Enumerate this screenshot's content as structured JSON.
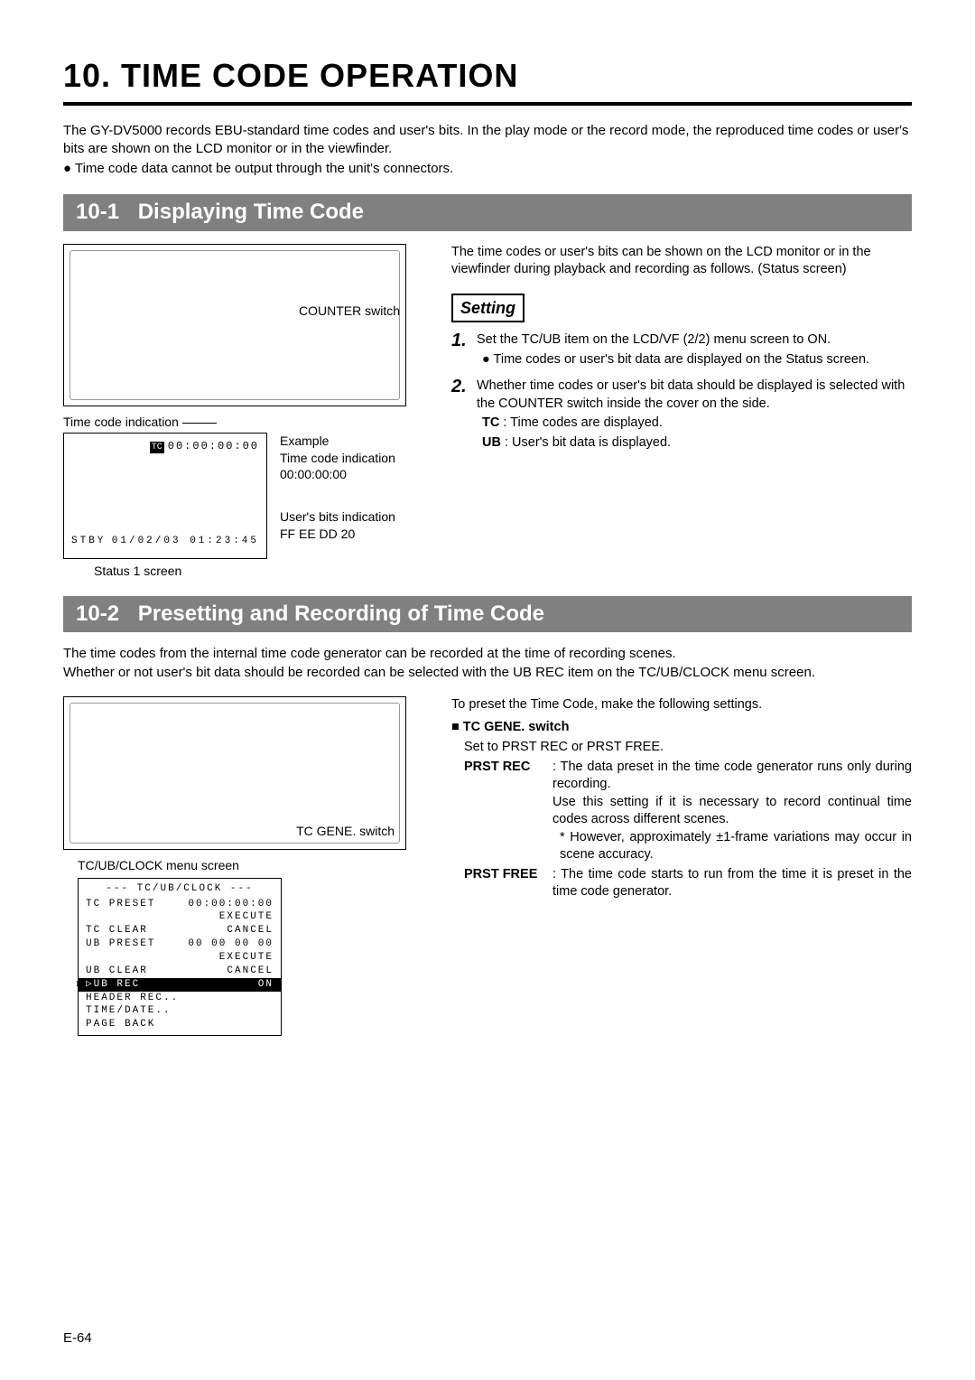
{
  "chapter_title": "10. TIME CODE OPERATION",
  "intro": {
    "p1": "The GY-DV5000 records EBU-standard time codes and user's bits. In the play mode or the record mode, the reproduced time codes or user's bits are shown on the LCD monitor or in the viewfinder.",
    "p2": "Time code data cannot be output through the unit's connectors."
  },
  "section_10_1": {
    "number": "10-1",
    "title": "Displaying Time Code",
    "counter_switch_label": "COUNTER switch",
    "tc_indication_label": "Time code indication",
    "lcd": {
      "tc_badge": "TC",
      "tc_value": "00:00:00:00",
      "stby": "STBY",
      "date": "01/02/03 01:23:45"
    },
    "example_label": "Example",
    "example_tc_label": "Time code indication",
    "example_tc_value": "00:00:00:00",
    "example_ub_label": "User's bits indication",
    "example_ub_value": "FF EE DD 20",
    "status1_caption": "Status 1 screen",
    "right_intro": "The time codes or user's bits can be shown on the LCD monitor or in the viewfinder during playback and recording as follows. (Status screen)",
    "setting_label": "Setting",
    "step1": {
      "text": "Set the TC/UB item on the LCD/VF (2/2) menu screen to ON.",
      "bullet": "Time codes or user's bit data are displayed on the Status screen."
    },
    "step2": {
      "text": "Whether time codes or user's bit data should be displayed is selected with the COUNTER switch inside the cover on the side.",
      "tc_label": "TC",
      "tc_text": ": Time codes are displayed.",
      "ub_label": "UB",
      "ub_text": ": User's bit data is displayed."
    }
  },
  "section_10_2": {
    "number": "10-2",
    "title": "Presetting and Recording of Time Code",
    "intro1": "The time codes from the internal time code generator can be recorded at the time of recording scenes.",
    "intro2": "Whether or not user's bit data should be recorded can be selected with the UB REC item on the TC/UB/CLOCK menu screen.",
    "tc_gene_label": "TC GENE. switch",
    "menu_caption": "TC/UB/CLOCK menu screen",
    "menu": {
      "title": "--- TC/UB/CLOCK ---",
      "rows": [
        {
          "k": "TC PRESET",
          "v": "00:00:00:00"
        },
        {
          "k": "",
          "v": "EXECUTE"
        },
        {
          "k": "TC CLEAR",
          "v": "CANCEL"
        },
        {
          "k": "UB PRESET",
          "v": "00 00 00 00"
        },
        {
          "k": "",
          "v": "EXECUTE"
        },
        {
          "k": "UB CLEAR",
          "v": "CANCEL"
        },
        {
          "k": "UB REC",
          "v": "ON",
          "sel": true
        },
        {
          "k": "HEADER REC..",
          "v": ""
        },
        {
          "k": "TIME/DATE..",
          "v": ""
        },
        {
          "k": "PAGE BACK",
          "v": ""
        }
      ]
    },
    "right": {
      "intro": "To preset the Time Code, make the following settings.",
      "switch_head": "TC GENE. switch",
      "set_to": "Set to PRST REC or PRST FREE.",
      "prst_rec_key": "PRST REC",
      "prst_rec_text": ": The data preset in the time code generator runs only during recording.",
      "prst_rec_use": "Use this setting if it is necessary to record continual time codes across different scenes.",
      "prst_rec_star": "* However, approximately ±1-frame variations may occur in scene accuracy.",
      "prst_free_key": "PRST FREE",
      "prst_free_text": ": The time code starts to run from the time it is preset in the time code generator."
    }
  },
  "page_number": "E-64"
}
